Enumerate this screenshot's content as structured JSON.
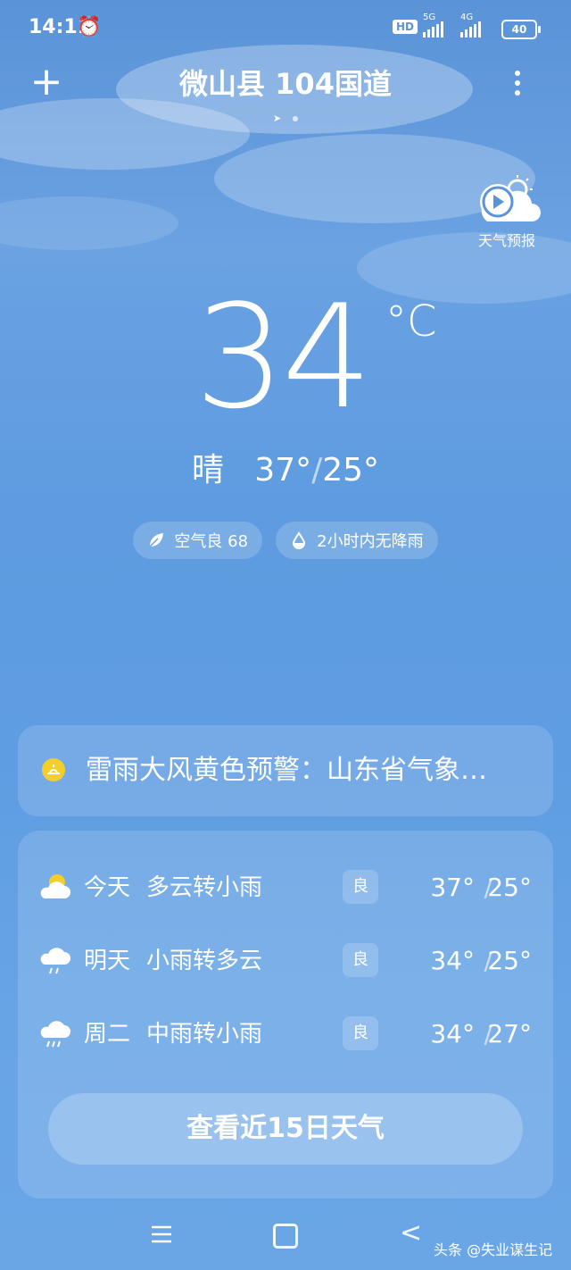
{
  "status_bar": {
    "time": "14:11",
    "hd": "HD",
    "network1": "5G",
    "network2": "4G",
    "battery": "40"
  },
  "header": {
    "location": "微山县 104国道"
  },
  "forecast_button": {
    "label": "天气预报"
  },
  "current": {
    "temperature": "34",
    "unit": "°C",
    "condition": "晴",
    "high": "37°",
    "low": "25°"
  },
  "chips": {
    "air": "空气良 68",
    "rain": "2小时内无降雨"
  },
  "alert": {
    "text": "雷雨大风黄色预警：山东省气象…"
  },
  "daily": [
    {
      "day": "今天",
      "weather": "多云转小雨",
      "aq": "良",
      "high": "37°",
      "low": "25°",
      "icon": "partly-cloudy-icon"
    },
    {
      "day": "明天",
      "weather": "小雨转多云",
      "aq": "良",
      "high": "34°",
      "low": "25°",
      "icon": "light-rain-icon"
    },
    {
      "day": "周二",
      "weather": "中雨转小雨",
      "aq": "良",
      "high": "34°",
      "low": "27°",
      "icon": "moderate-rain-icon"
    }
  ],
  "daily_button": {
    "label": "查看近15日天气"
  },
  "watermark": "头条 @失业谋生记"
}
